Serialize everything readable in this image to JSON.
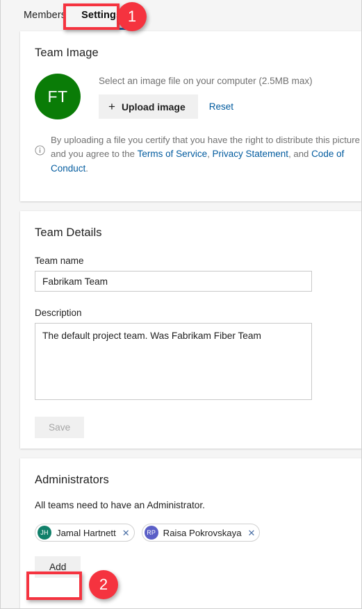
{
  "tabs": [
    {
      "label": "Members",
      "active": false
    },
    {
      "label": "Settings",
      "active": true
    }
  ],
  "team_image": {
    "title": "Team Image",
    "avatar_initials": "FT",
    "avatar_color": "#0a7c07",
    "hint": "Select an image file on your computer (2.5MB max)",
    "upload_label": "Upload image",
    "upload_icon": "plus-icon",
    "reset_label": "Reset",
    "disclaimer": {
      "icon": "info-circle-icon",
      "part1": "By uploading a file you certify that you have the right to distribute this picture and you agree to the ",
      "link1": "Terms of Service",
      "part2": ", ",
      "link2": "Privacy Statement",
      "part3": ", and ",
      "link3": "Code of Conduct",
      "part4": "."
    }
  },
  "team_details": {
    "title": "Team Details",
    "name_label": "Team name",
    "name_value": "Fabrikam Team",
    "name_placeholder": "Team name",
    "description_label": "Description",
    "description_value": "The default project team. Was Fabrikam Fiber Team",
    "description_placeholder": "Description",
    "save_label": "Save",
    "save_disabled": true
  },
  "administrators": {
    "title": "Administrators",
    "note": "All teams need to have an Administrator.",
    "chips": [
      {
        "initials": "JH",
        "name": "Jamal Hartnett",
        "color": "#11806a",
        "remove_icon": "close-icon"
      },
      {
        "initials": "RP",
        "name": "Raisa Pokrovskaya",
        "color": "#5b5fc7",
        "remove_icon": "close-icon"
      }
    ],
    "add_label": "Add"
  },
  "annotations": [
    {
      "number": "1",
      "target": "settings-tab"
    },
    {
      "number": "2",
      "target": "add-button"
    }
  ],
  "colors": {
    "accent_blue": "#2768a8",
    "link_blue": "#005a9e",
    "annotation_red": "#f5333f",
    "page_bg": "#f5f5f5"
  }
}
